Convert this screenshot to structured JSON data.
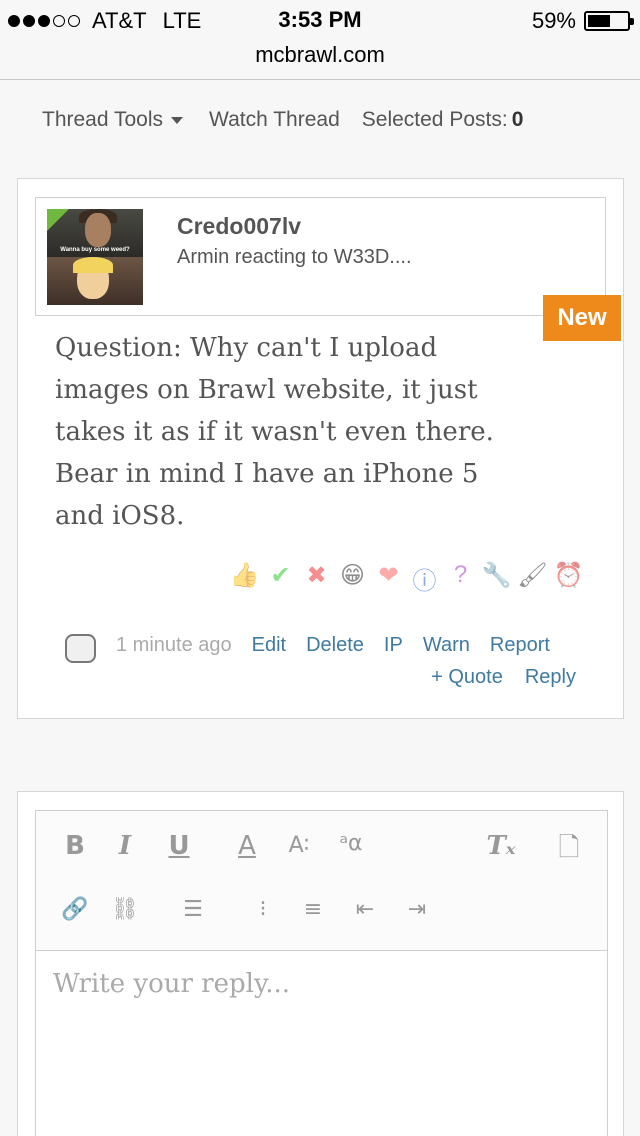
{
  "status_bar": {
    "carrier": "AT&T",
    "network": "LTE",
    "time": "3:53 PM",
    "battery": "59%",
    "battery_level": 0.59,
    "url": "mcbrawl.com"
  },
  "thread_tools": {
    "tools_label": "Thread Tools",
    "watch_label": "Watch Thread",
    "selected_label": "Selected Posts:",
    "selected_count": "0"
  },
  "post": {
    "username": "Credo007lv",
    "user_title": "Armin reacting to W33D....",
    "avatar_caption": "Wanna buy some weed?",
    "new_badge": "New",
    "message": "Question: Why can't I upload images on Brawl website, it just takes it as if it wasn't even there. Bear in mind I have an iPhone 5 and iOS8.",
    "reactions": [
      "like-icon",
      "agree-icon",
      "disagree-icon",
      "funny-icon",
      "love-icon",
      "informative-icon",
      "question-icon",
      "useful-icon",
      "creative-icon",
      "late-icon"
    ],
    "time": "1 minute ago",
    "actions": {
      "edit": "Edit",
      "delete": "Delete",
      "ip": "IP",
      "warn": "Warn",
      "report": "Report",
      "quote": "+ Quote",
      "reply": "Reply"
    }
  },
  "reply": {
    "placeholder": "Write your reply...",
    "toolbar": {
      "bold": "B",
      "italic": "I",
      "underline": "U",
      "font_color": "A",
      "font_size": "A∶",
      "font_family": "ᵃα",
      "remove_format": "Tₓ"
    }
  },
  "colors": {
    "new_badge": "#ee8a1b",
    "link": "#3f7aa3"
  }
}
